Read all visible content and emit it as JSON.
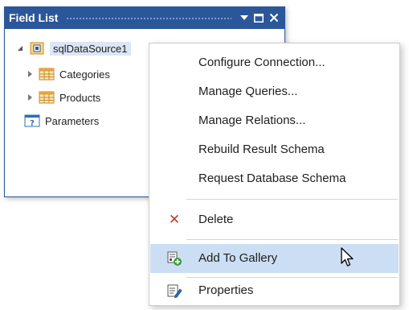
{
  "panel": {
    "title": "Field List",
    "title_bar_color": "#2b579a"
  },
  "tree": {
    "root": {
      "label": "sqlDataSource1",
      "icon": "datasource-icon"
    },
    "children": [
      {
        "label": "Categories",
        "icon": "table-icon"
      },
      {
        "label": "Products",
        "icon": "table-icon"
      }
    ],
    "parameters": {
      "label": "Parameters",
      "icon": "parameters-icon"
    }
  },
  "context_menu": {
    "items": [
      {
        "label": "Configure Connection..."
      },
      {
        "label": "Manage Queries..."
      },
      {
        "label": "Manage Relations..."
      },
      {
        "label": "Rebuild Result Schema"
      },
      {
        "label": "Request Database Schema"
      },
      {
        "label": "Delete",
        "icon": "delete-icon"
      },
      {
        "label": "Add To Gallery",
        "icon": "add-to-gallery-icon",
        "highlighted": true
      },
      {
        "label": "Properties",
        "icon": "properties-icon"
      }
    ],
    "highlight_color": "#ccdef3"
  }
}
